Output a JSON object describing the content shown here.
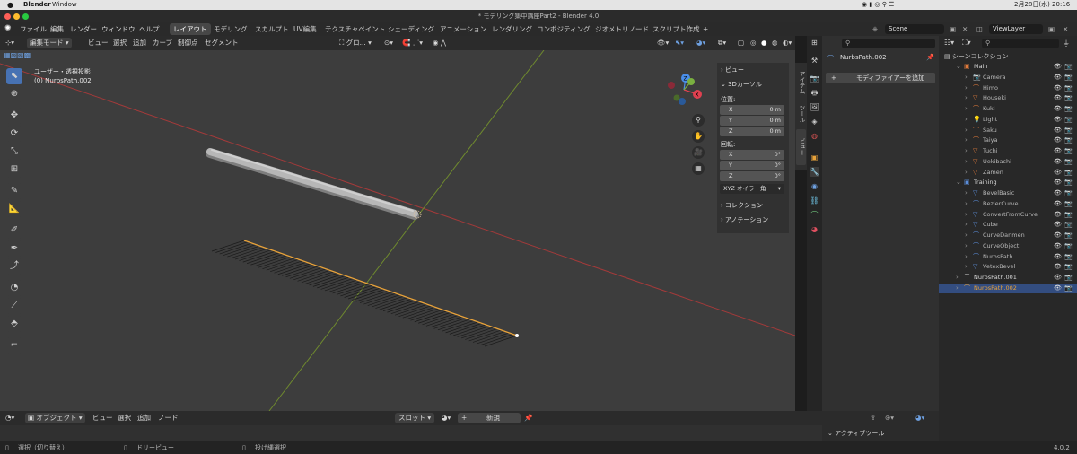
{
  "macbar": {
    "app": "Blender",
    "window": "Window",
    "datetime": "2月28日(水) 20:16"
  },
  "window": {
    "title": "* モデリング集中講座Part2 - Blender 4.0"
  },
  "topbar": {
    "menus": [
      "ファイル",
      "編集",
      "レンダー",
      "ウィンドウ",
      "ヘルプ"
    ],
    "workspaces": [
      "レイアウト",
      "モデリング",
      "スカルプト",
      "UV編集",
      "テクスチャペイント",
      "シェーディング",
      "アニメーション",
      "レンダリング",
      "コンポジティング",
      "ジオメトリノード",
      "スクリプト作成"
    ],
    "active_workspace": "レイアウト",
    "add_tab": "+",
    "scene": "Scene",
    "view_layer": "ViewLayer"
  },
  "viewport_header": {
    "mode": "編集モード",
    "menus": [
      "ビュー",
      "選択",
      "追加",
      "カーブ",
      "制御点",
      "セグメント"
    ],
    "transform": "グロ..."
  },
  "viewport": {
    "view_name": "ユーザー・透視投影",
    "object_info": "(0) NurbsPath.002",
    "gizmo": {
      "x": "X",
      "y": "Y",
      "z": "Z"
    }
  },
  "npanel": {
    "view_section": "ビュー",
    "cursor_section": "3Dカーソル",
    "location_label": "位置:",
    "location": [
      {
        "axis": "X",
        "value": "0 m"
      },
      {
        "axis": "Y",
        "value": "0 m"
      },
      {
        "axis": "Z",
        "value": "0 m"
      }
    ],
    "rotation_label": "回転:",
    "rotation": [
      {
        "axis": "X",
        "value": "0°"
      },
      {
        "axis": "Y",
        "value": "0°"
      },
      {
        "axis": "Z",
        "value": "0°"
      }
    ],
    "rotation_mode": "XYZ オイラー角",
    "collection_section": "コレクション",
    "annotation_section": "アノテーション",
    "tabs": [
      "アイテム",
      "ツール",
      "ビュー"
    ]
  },
  "properties": {
    "object_name": "NurbsPath.002",
    "add_modifier": "モディファイアーを追加"
  },
  "outliner": {
    "title": "シーンコレクション",
    "rows": [
      {
        "name": "Main",
        "icon": "collection",
        "depth": 1,
        "color": "#e07a3b"
      },
      {
        "name": "Camera",
        "icon": "camera",
        "depth": 2,
        "color": "#e07a3b"
      },
      {
        "name": "Himo",
        "icon": "curve",
        "depth": 2,
        "color": "#e07a3b"
      },
      {
        "name": "Houseki",
        "icon": "mesh",
        "depth": 2,
        "color": "#e07a3b"
      },
      {
        "name": "Kuki",
        "icon": "curve",
        "depth": 2,
        "color": "#e07a3b"
      },
      {
        "name": "Light",
        "icon": "light",
        "depth": 2,
        "color": "#e07a3b"
      },
      {
        "name": "Saku",
        "icon": "curve",
        "depth": 2,
        "color": "#e07a3b"
      },
      {
        "name": "Taiya",
        "icon": "curve",
        "depth": 2,
        "color": "#e07a3b"
      },
      {
        "name": "Tuchi",
        "icon": "mesh",
        "depth": 2,
        "color": "#e07a3b"
      },
      {
        "name": "Uekibachi",
        "icon": "mesh",
        "depth": 2,
        "color": "#e07a3b"
      },
      {
        "name": "Zamen",
        "icon": "mesh",
        "depth": 2,
        "color": "#e07a3b"
      },
      {
        "name": "Training",
        "icon": "collection",
        "depth": 1,
        "color": "#5b8dd9"
      },
      {
        "name": "BevelBasic",
        "icon": "mesh",
        "depth": 2,
        "color": "#5b8dd9"
      },
      {
        "name": "BezierCurve",
        "icon": "curve",
        "depth": 2,
        "color": "#5b8dd9"
      },
      {
        "name": "ConvertFromCurve",
        "icon": "mesh",
        "depth": 2,
        "color": "#5b8dd9"
      },
      {
        "name": "Cube",
        "icon": "mesh",
        "depth": 2,
        "color": "#5b8dd9"
      },
      {
        "name": "CurveDanmen",
        "icon": "curve",
        "depth": 2,
        "color": "#5b8dd9"
      },
      {
        "name": "CurveObject",
        "icon": "curve",
        "depth": 2,
        "color": "#5b8dd9"
      },
      {
        "name": "NurbsPath",
        "icon": "curve",
        "depth": 2,
        "color": "#5b8dd9"
      },
      {
        "name": "VetexBevel",
        "icon": "mesh",
        "depth": 2,
        "color": "#5b8dd9"
      },
      {
        "name": "NurbsPath.001",
        "icon": "curve",
        "depth": 1,
        "color": "#cccccc"
      },
      {
        "name": "NurbsPath.002",
        "icon": "curve",
        "depth": 1,
        "color": "#e8a23a",
        "selected": true
      }
    ]
  },
  "bottom_header": {
    "mode": "オブジェクト",
    "menus": [
      "ビュー",
      "選択",
      "追加",
      "ノード"
    ],
    "slot": "スロット",
    "new": "新規"
  },
  "active_tool": {
    "label": "アクティブツール"
  },
  "status": {
    "select": "選択（切り替え）",
    "dolly": "ドリービュー",
    "lasso": "投げ縄選択",
    "version": "4.0.2"
  }
}
